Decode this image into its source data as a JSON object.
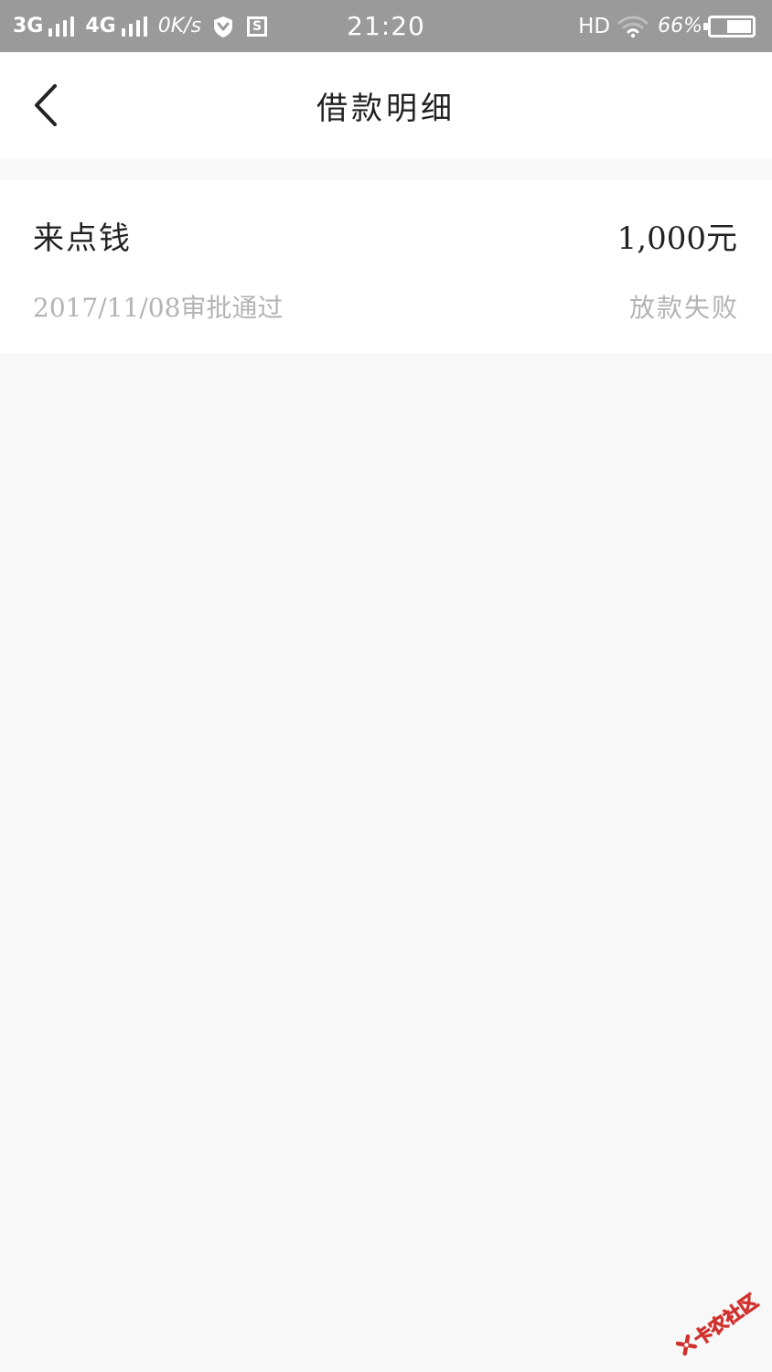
{
  "status_bar": {
    "network_1": "3G",
    "network_2": "4G",
    "speed": "0K/s",
    "time": "21:20",
    "hd": "HD",
    "battery_percent": "66%",
    "battery_level": 0.66,
    "icons": [
      "signal-icon",
      "signal-icon",
      "shield-icon",
      "s-box-icon",
      "wifi-icon",
      "battery-icon"
    ]
  },
  "header": {
    "title": "借款明细",
    "back_icon": "chevron-left-icon"
  },
  "loan_record": {
    "lender": "来点钱",
    "amount": "1,000元",
    "approval_info": "2017/11/08审批通过",
    "status": "放款失败"
  },
  "watermark": {
    "text": "卡农社区",
    "accent_color": "#d0312d"
  },
  "colors": {
    "status_bar_bg": "#9a9a9a",
    "page_bg": "#f8f8f8",
    "card_bg": "#ffffff",
    "primary_text": "#222222",
    "secondary_text": "#b3b3b3"
  }
}
